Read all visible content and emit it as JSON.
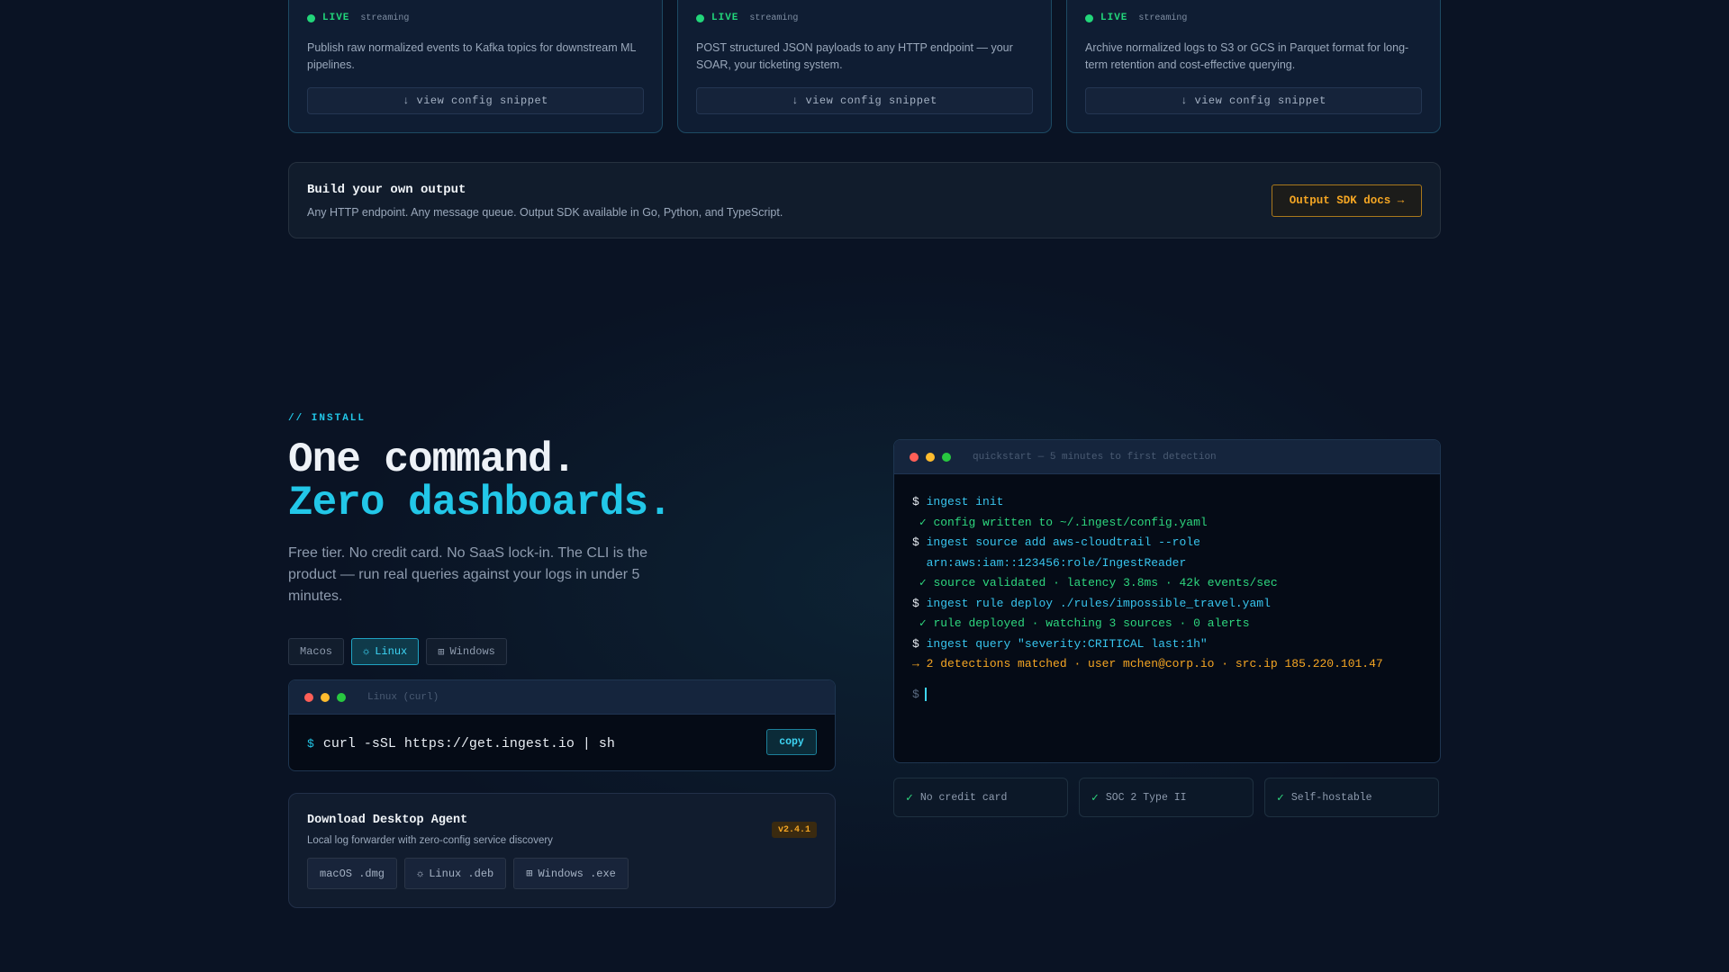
{
  "outputs": [
    {
      "status": "LIVE",
      "mode": "streaming",
      "description": "Publish raw normalized events to Kafka topics for downstream ML pipelines.",
      "button_label": "↓ view config snippet"
    },
    {
      "status": "LIVE",
      "mode": "streaming",
      "description": "POST structured JSON payloads to any HTTP endpoint — your SOAR, your ticketing system.",
      "button_label": "↓ view config snippet"
    },
    {
      "status": "LIVE",
      "mode": "streaming",
      "description": "Archive normalized logs to S3 or GCS in Parquet format for long-term retention and cost-effective querying.",
      "button_label": "↓ view config snippet"
    }
  ],
  "build": {
    "title": "Build your own output",
    "subtitle": "Any HTTP endpoint. Any message queue. Output SDK available in Go, Python, and TypeScript.",
    "button_label": "Output SDK docs →"
  },
  "install": {
    "label": "// INSTALL",
    "headline_1": "One command.",
    "headline_2": "Zero dashboards.",
    "lead": "Free tier. No credit card. No SaaS lock-in. The CLI is the product — run real queries against your logs in under 5 minutes.",
    "os_tabs": [
      {
        "label": "Macos",
        "icon": ""
      },
      {
        "label": "Linux",
        "icon": "☼"
      },
      {
        "label": "Windows",
        "icon": "⊞"
      }
    ],
    "active_tab": "Linux",
    "terminal_title": "Linux (curl)",
    "prompt": "$",
    "command": "curl -sSL https://get.ingest.io | sh",
    "copy_label": "copy"
  },
  "agent": {
    "title": "Download Desktop Agent",
    "subtitle": "Local log forwarder with zero-config service discovery",
    "version": "v2.4.1",
    "downloads": [
      {
        "label": "macOS .dmg",
        "icon": ""
      },
      {
        "label": "Linux .deb",
        "icon": "☼"
      },
      {
        "label": "Windows .exe",
        "icon": "⊞"
      }
    ]
  },
  "quickstart": {
    "title": "quickstart — 5 minutes to first detection",
    "lines": [
      {
        "kind": "cmd",
        "prefix": "$",
        "text": "ingest init"
      },
      {
        "kind": "ok",
        "prefix": "✓",
        "text": "config written to ~/.ingest/config.yaml"
      },
      {
        "kind": "cmd",
        "prefix": "$",
        "text": "ingest source add aws-cloudtrail --role"
      },
      {
        "kind": "cont",
        "prefix": "",
        "text": "arn:aws:iam::123456:role/IngestReader"
      },
      {
        "kind": "ok",
        "prefix": "✓",
        "text": "source validated · latency 3.8ms · 42k events/sec"
      },
      {
        "kind": "cmd",
        "prefix": "$",
        "text": "ingest rule deploy ./rules/impossible_travel.yaml"
      },
      {
        "kind": "ok",
        "prefix": "✓",
        "text": "rule deployed · watching 3 sources · 0 alerts"
      },
      {
        "kind": "cmd",
        "prefix": "$",
        "text": "ingest query \"severity:CRITICAL last:1h\""
      },
      {
        "kind": "warn",
        "prefix": "→",
        "text": "2 detections matched · user mchen@corp.io · src.ip 185.220.101.47"
      }
    ],
    "cursor_prompt": "$"
  },
  "features": [
    {
      "label": "No credit card"
    },
    {
      "label": "SOC 2 Type II"
    },
    {
      "label": "Self-hostable"
    }
  ],
  "colors": {
    "accent": "#22c7e8",
    "live": "#22d67a",
    "warning": "#f5a623"
  }
}
